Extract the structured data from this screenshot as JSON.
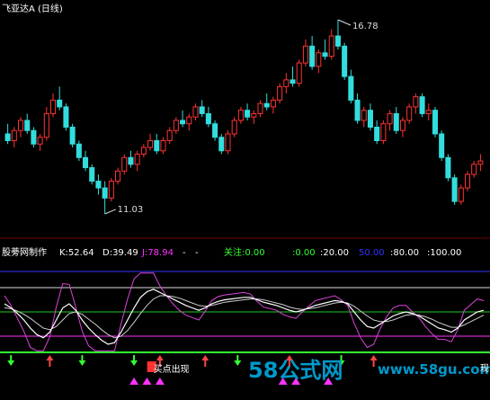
{
  "chart_data": {
    "type": "candlestick",
    "title": "飞亚达A (日线)",
    "price": {
      "high_label": "16.78",
      "low_label": "11.03",
      "candles": [
        {
          "o": 13.4,
          "h": 13.7,
          "l": 13.1,
          "c": 13.2
        },
        {
          "o": 13.2,
          "h": 13.6,
          "l": 13.0,
          "c": 13.5
        },
        {
          "o": 13.5,
          "h": 13.9,
          "l": 13.3,
          "c": 13.8
        },
        {
          "o": 13.8,
          "h": 14.0,
          "l": 13.4,
          "c": 13.5
        },
        {
          "o": 13.5,
          "h": 13.6,
          "l": 13.0,
          "c": 13.1
        },
        {
          "o": 13.1,
          "h": 13.4,
          "l": 12.9,
          "c": 13.3
        },
        {
          "o": 13.3,
          "h": 14.2,
          "l": 13.2,
          "c": 14.0
        },
        {
          "o": 14.0,
          "h": 14.6,
          "l": 13.9,
          "c": 14.4
        },
        {
          "o": 14.4,
          "h": 14.8,
          "l": 14.1,
          "c": 14.2
        },
        {
          "o": 14.2,
          "h": 14.3,
          "l": 13.5,
          "c": 13.6
        },
        {
          "o": 13.6,
          "h": 13.7,
          "l": 13.0,
          "c": 13.1
        },
        {
          "o": 13.1,
          "h": 13.2,
          "l": 12.6,
          "c": 12.7
        },
        {
          "o": 12.7,
          "h": 12.9,
          "l": 12.3,
          "c": 12.4
        },
        {
          "o": 12.4,
          "h": 12.5,
          "l": 11.9,
          "c": 12.0
        },
        {
          "o": 12.0,
          "h": 12.2,
          "l": 11.6,
          "c": 11.8
        },
        {
          "o": 11.8,
          "h": 12.0,
          "l": 11.03,
          "c": 11.5
        },
        {
          "o": 11.5,
          "h": 12.1,
          "l": 11.4,
          "c": 12.0
        },
        {
          "o": 12.0,
          "h": 12.4,
          "l": 11.9,
          "c": 12.3
        },
        {
          "o": 12.3,
          "h": 12.8,
          "l": 12.2,
          "c": 12.7
        },
        {
          "o": 12.7,
          "h": 12.9,
          "l": 12.4,
          "c": 12.5
        },
        {
          "o": 12.5,
          "h": 12.9,
          "l": 12.3,
          "c": 12.8
        },
        {
          "o": 12.8,
          "h": 13.1,
          "l": 12.7,
          "c": 13.0
        },
        {
          "o": 13.0,
          "h": 13.4,
          "l": 12.9,
          "c": 13.2
        },
        {
          "o": 13.2,
          "h": 13.4,
          "l": 12.8,
          "c": 12.9
        },
        {
          "o": 12.9,
          "h": 13.3,
          "l": 12.8,
          "c": 13.2
        },
        {
          "o": 13.2,
          "h": 13.6,
          "l": 13.1,
          "c": 13.5
        },
        {
          "o": 13.5,
          "h": 13.9,
          "l": 13.4,
          "c": 13.8
        },
        {
          "o": 13.8,
          "h": 14.1,
          "l": 13.6,
          "c": 13.7
        },
        {
          "o": 13.7,
          "h": 14.0,
          "l": 13.5,
          "c": 13.9
        },
        {
          "o": 13.9,
          "h": 14.3,
          "l": 13.8,
          "c": 14.2
        },
        {
          "o": 14.2,
          "h": 14.4,
          "l": 13.9,
          "c": 14.0
        },
        {
          "o": 14.0,
          "h": 14.2,
          "l": 13.6,
          "c": 13.7
        },
        {
          "o": 13.7,
          "h": 13.8,
          "l": 13.2,
          "c": 13.3
        },
        {
          "o": 13.3,
          "h": 13.4,
          "l": 12.8,
          "c": 12.9
        },
        {
          "o": 12.9,
          "h": 13.5,
          "l": 12.8,
          "c": 13.4
        },
        {
          "o": 13.4,
          "h": 13.9,
          "l": 13.3,
          "c": 13.8
        },
        {
          "o": 13.8,
          "h": 14.2,
          "l": 13.7,
          "c": 14.1
        },
        {
          "o": 14.1,
          "h": 14.3,
          "l": 13.8,
          "c": 13.9
        },
        {
          "o": 13.9,
          "h": 14.1,
          "l": 13.7,
          "c": 14.0
        },
        {
          "o": 14.0,
          "h": 14.4,
          "l": 13.9,
          "c": 14.3
        },
        {
          "o": 14.3,
          "h": 14.6,
          "l": 14.1,
          "c": 14.2
        },
        {
          "o": 14.2,
          "h": 14.5,
          "l": 14.0,
          "c": 14.4
        },
        {
          "o": 14.4,
          "h": 14.9,
          "l": 14.3,
          "c": 14.8
        },
        {
          "o": 14.8,
          "h": 15.2,
          "l": 14.6,
          "c": 15.0
        },
        {
          "o": 15.0,
          "h": 15.4,
          "l": 14.8,
          "c": 14.9
        },
        {
          "o": 14.9,
          "h": 15.6,
          "l": 14.8,
          "c": 15.5
        },
        {
          "o": 15.5,
          "h": 16.2,
          "l": 15.4,
          "c": 16.0
        },
        {
          "o": 16.0,
          "h": 16.3,
          "l": 15.3,
          "c": 15.4
        },
        {
          "o": 15.4,
          "h": 15.9,
          "l": 15.2,
          "c": 15.8
        },
        {
          "o": 15.8,
          "h": 16.2,
          "l": 15.6,
          "c": 15.7
        },
        {
          "o": 15.7,
          "h": 16.5,
          "l": 15.6,
          "c": 16.3
        },
        {
          "o": 16.3,
          "h": 16.78,
          "l": 15.9,
          "c": 16.0
        },
        {
          "o": 16.0,
          "h": 16.1,
          "l": 15.0,
          "c": 15.1
        },
        {
          "o": 15.1,
          "h": 15.3,
          "l": 14.3,
          "c": 14.4
        },
        {
          "o": 14.4,
          "h": 14.6,
          "l": 13.7,
          "c": 13.8
        },
        {
          "o": 13.8,
          "h": 14.2,
          "l": 13.6,
          "c": 14.1
        },
        {
          "o": 14.1,
          "h": 14.3,
          "l": 13.5,
          "c": 13.6
        },
        {
          "o": 13.6,
          "h": 13.8,
          "l": 13.1,
          "c": 13.2
        },
        {
          "o": 13.2,
          "h": 13.8,
          "l": 13.1,
          "c": 13.7
        },
        {
          "o": 13.7,
          "h": 14.1,
          "l": 13.5,
          "c": 14.0
        },
        {
          "o": 14.0,
          "h": 14.2,
          "l": 13.4,
          "c": 13.5
        },
        {
          "o": 13.5,
          "h": 13.9,
          "l": 13.3,
          "c": 13.8
        },
        {
          "o": 13.8,
          "h": 14.3,
          "l": 13.7,
          "c": 14.2
        },
        {
          "o": 14.2,
          "h": 14.6,
          "l": 14.0,
          "c": 14.5
        },
        {
          "o": 14.5,
          "h": 14.6,
          "l": 13.9,
          "c": 14.0
        },
        {
          "o": 14.0,
          "h": 14.3,
          "l": 13.8,
          "c": 14.1
        },
        {
          "o": 14.1,
          "h": 14.2,
          "l": 13.3,
          "c": 13.4
        },
        {
          "o": 13.4,
          "h": 13.5,
          "l": 12.6,
          "c": 12.7
        },
        {
          "o": 12.7,
          "h": 12.8,
          "l": 12.0,
          "c": 12.1
        },
        {
          "o": 12.1,
          "h": 12.2,
          "l": 11.3,
          "c": 11.4
        },
        {
          "o": 11.4,
          "h": 11.9,
          "l": 11.3,
          "c": 11.8
        },
        {
          "o": 11.8,
          "h": 12.3,
          "l": 11.7,
          "c": 12.2
        },
        {
          "o": 12.2,
          "h": 12.6,
          "l": 12.1,
          "c": 12.5
        },
        {
          "o": 12.5,
          "h": 12.8,
          "l": 12.3,
          "c": 12.6
        }
      ]
    },
    "indicator": {
      "name": "股蒡网制作",
      "labels": [
        {
          "text": "K:52.64",
          "color": "#ffffff"
        },
        {
          "text": "D:39.49",
          "color": "#ffffff"
        },
        {
          "text": "J:78.94",
          "color": "#ff33ff"
        },
        {
          "text": "-",
          "color": "#ffffff"
        },
        {
          "text": "-",
          "color": "#ffffff"
        },
        {
          "text": "关注:0.00",
          "color": "#33ff33"
        },
        {
          "text": ":0.00",
          "color": "#33ff33"
        },
        {
          "text": ":20.00",
          "color": "#ffffff"
        },
        {
          "text": "50.00",
          "color": "#3333ff"
        },
        {
          "text": ":80.00",
          "color": "#ffffff"
        },
        {
          "text": ":100.00",
          "color": "#ffffff"
        }
      ],
      "ylim": [
        0,
        100
      ],
      "ref_lines": [
        {
          "value": 100,
          "color": "#3333ff"
        },
        {
          "value": 80,
          "color": "#dddddd"
        },
        {
          "value": 50,
          "color": "#22cc22"
        },
        {
          "value": 20,
          "color": "#ff33ff"
        },
        {
          "value": 0,
          "color": "#33ff33"
        }
      ],
      "k": [
        60,
        55,
        48,
        40,
        30,
        22,
        18,
        25,
        40,
        55,
        60,
        52,
        40,
        30,
        22,
        15,
        10,
        12,
        25,
        40,
        55,
        68,
        75,
        78,
        74,
        70,
        66,
        62,
        58,
        55,
        52,
        55,
        60,
        63,
        65,
        66,
        67,
        68,
        68,
        65,
        62,
        60,
        58,
        55,
        52,
        50,
        52,
        55,
        58,
        60,
        62,
        64,
        63,
        60,
        50,
        40,
        32,
        30,
        35,
        40,
        45,
        48,
        50,
        48,
        45,
        40,
        35,
        30,
        28,
        25,
        30,
        40,
        45,
        50,
        52
      ],
      "d": [
        55,
        54,
        51,
        47,
        42,
        36,
        30,
        28,
        32,
        40,
        48,
        50,
        47,
        41,
        35,
        28,
        22,
        18,
        20,
        27,
        37,
        48,
        58,
        66,
        70,
        70,
        69,
        67,
        64,
        61,
        58,
        57,
        58,
        60,
        62,
        63,
        64,
        65,
        66,
        66,
        65,
        63,
        61,
        59,
        56,
        54,
        53,
        54,
        55,
        57,
        59,
        61,
        62,
        61,
        57,
        51,
        45,
        40,
        38,
        38,
        40,
        43,
        46,
        47,
        46,
        44,
        41,
        37,
        34,
        31,
        31,
        34,
        38,
        42,
        46
      ],
      "j": [
        70,
        58,
        42,
        26,
        6,
        2,
        2,
        19,
        56,
        85,
        84,
        56,
        26,
        8,
        2,
        2,
        2,
        2,
        35,
        66,
        91,
        98,
        98,
        98,
        82,
        70,
        60,
        52,
        46,
        43,
        40,
        51,
        64,
        69,
        71,
        72,
        73,
        74,
        72,
        63,
        56,
        54,
        52,
        47,
        44,
        42,
        50,
        57,
        64,
        66,
        68,
        70,
        65,
        58,
        36,
        18,
        6,
        10,
        29,
        44,
        55,
        58,
        58,
        50,
        43,
        32,
        23,
        16,
        16,
        13,
        28,
        52,
        59,
        66,
        64
      ],
      "signals": [
        {
          "i": 1,
          "type": "down",
          "color": "#33ff33"
        },
        {
          "i": 7,
          "type": "up",
          "color": "#ff4444"
        },
        {
          "i": 12,
          "type": "down",
          "color": "#33ff33"
        },
        {
          "i": 20,
          "type": "down",
          "color": "#33ff33"
        },
        {
          "i": 24,
          "type": "up",
          "color": "#ff4444"
        },
        {
          "i": 31,
          "type": "up",
          "color": "#ff4444"
        },
        {
          "i": 36,
          "type": "down",
          "color": "#33ff33"
        },
        {
          "i": 44,
          "type": "up",
          "color": "#ff4444"
        },
        {
          "i": 52,
          "type": "down",
          "color": "#33ff33"
        },
        {
          "i": 57,
          "type": "up",
          "color": "#ff4444"
        }
      ],
      "buy_labels": [
        {
          "i": 23,
          "text": "买点出现"
        }
      ],
      "triangles": [
        20,
        22,
        24,
        43,
        45,
        50
      ]
    },
    "watermark": {
      "main": "58公式网",
      "url": "www.58gu.com"
    },
    "edge_text": "现"
  }
}
